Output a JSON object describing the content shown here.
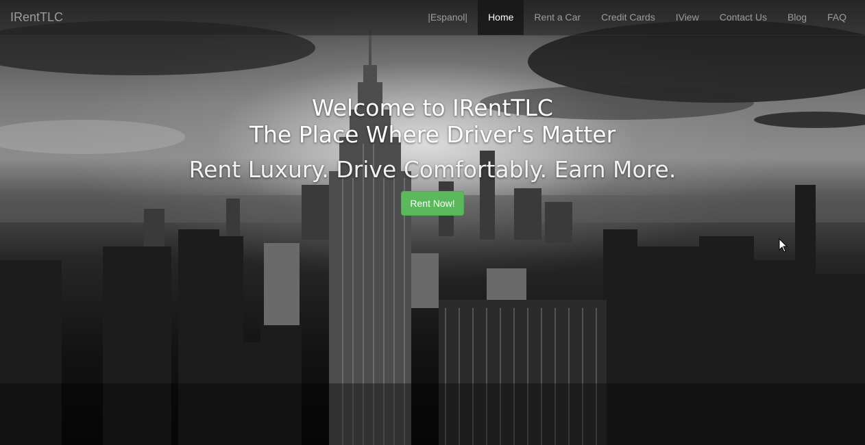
{
  "navbar": {
    "brand": "IRentTLC",
    "items": [
      {
        "label": "|Espanol|",
        "active": false
      },
      {
        "label": "Home",
        "active": true
      },
      {
        "label": "Rent a Car",
        "active": false
      },
      {
        "label": "Credit Cards",
        "active": false
      },
      {
        "label": "IView",
        "active": false
      },
      {
        "label": "Contact Us",
        "active": false
      },
      {
        "label": "Blog",
        "active": false
      },
      {
        "label": "FAQ",
        "active": false
      }
    ]
  },
  "hero": {
    "title_line1": "Welcome to IRentTLC",
    "title_line2": "The Place Where Driver's Matter",
    "tagline": "Rent Luxury. Drive Comfortably. Earn More.",
    "cta_label": "Rent Now!"
  },
  "colors": {
    "cta_green": "#5cb85c",
    "nav_text": "#9d9d9d",
    "nav_active_text": "#ffffff"
  }
}
